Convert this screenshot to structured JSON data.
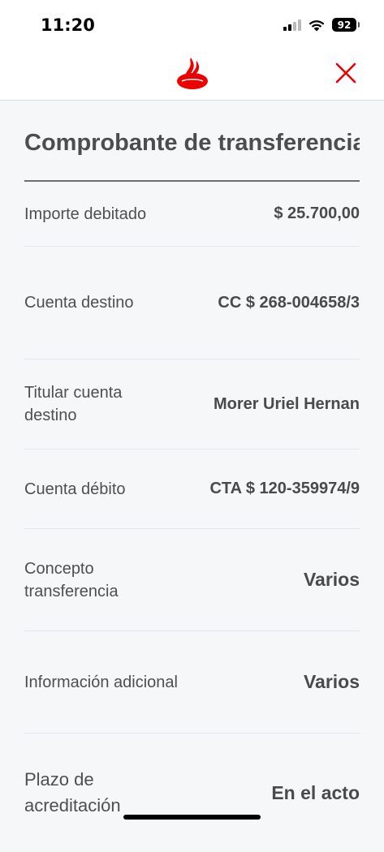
{
  "status_bar": {
    "time": "11:20",
    "battery": "92"
  },
  "header": {
    "logo_icon": "santander-flame-icon",
    "close_icon": "close-icon",
    "brand_color": "#ec0000"
  },
  "page": {
    "title": "Comprobante de transferencia"
  },
  "details": [
    {
      "label": "Importe debitado",
      "value": "$ 25.700,00"
    },
    {
      "label": "Cuenta destino",
      "value": "CC $ 268-004658/3"
    },
    {
      "label": "Titular cuenta destino",
      "value": "Morer  Uriel Hernan"
    },
    {
      "label": "Cuenta débito",
      "value": "CTA $ 120-359974/9"
    },
    {
      "label": "Concepto transferencia",
      "value": "Varios"
    },
    {
      "label": "Información adicional",
      "value": "Varios"
    },
    {
      "label": "Plazo de acreditación",
      "value": "En el acto"
    }
  ]
}
